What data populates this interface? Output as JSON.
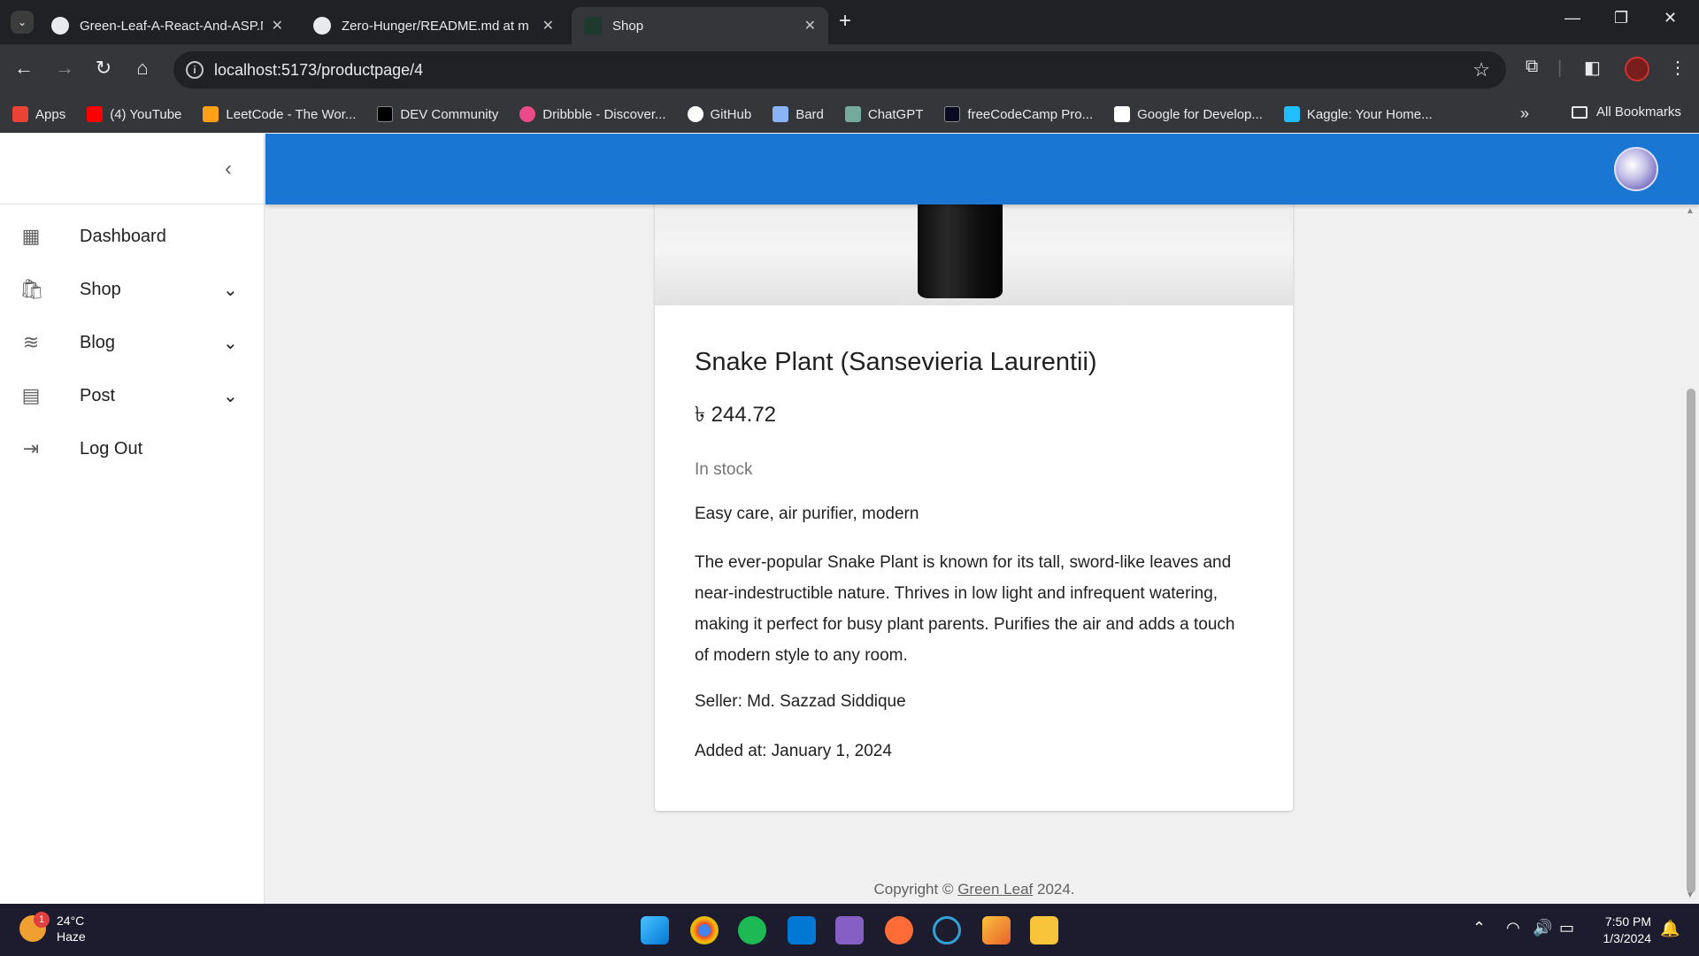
{
  "browser": {
    "tabs": [
      {
        "title": "Green-Leaf-A-React-And-ASP.N",
        "active": false
      },
      {
        "title": "Zero-Hunger/README.md at m",
        "active": false
      },
      {
        "title": "Shop",
        "active": true
      }
    ],
    "new_tab": "+",
    "url": "localhost:5173/productpage/4",
    "bookmarks": [
      {
        "label": "Apps",
        "icon": "apps-grid-icon",
        "color": "#ea4335"
      },
      {
        "label": "(4) YouTube",
        "icon": "youtube-icon",
        "color": "#ff0000"
      },
      {
        "label": "LeetCode - The Wor...",
        "icon": "leetcode-icon",
        "color": "#ffa116"
      },
      {
        "label": "DEV Community",
        "icon": "dev-icon",
        "color": "#000000"
      },
      {
        "label": "Dribbble - Discover...",
        "icon": "dribbble-icon",
        "color": "#ea4c89"
      },
      {
        "label": "GitHub",
        "icon": "github-icon",
        "color": "#ffffff"
      },
      {
        "label": "Bard",
        "icon": "bard-icon",
        "color": "#8ab4f8"
      },
      {
        "label": "ChatGPT",
        "icon": "chatgpt-icon",
        "color": "#74aa9c"
      },
      {
        "label": "freeCodeCamp Pro...",
        "icon": "freecodecamp-icon",
        "color": "#0a0a23"
      },
      {
        "label": "Google for Develop...",
        "icon": "google-icon",
        "color": "#4285f4"
      },
      {
        "label": "Kaggle: Your Home...",
        "icon": "kaggle-icon",
        "color": "#20beff"
      }
    ],
    "more_bookmarks": "»",
    "all_bookmarks": "All Bookmarks"
  },
  "sidebar": {
    "items": [
      {
        "label": "Dashboard",
        "icon": "dashboard-icon",
        "glyph": "▦",
        "chevron": false
      },
      {
        "label": "Shop",
        "icon": "shopping-bag-icon",
        "glyph": "🛍",
        "chevron": true
      },
      {
        "label": "Blog",
        "icon": "rss-feed-icon",
        "glyph": "≋",
        "chevron": true
      },
      {
        "label": "Post",
        "icon": "post-add-icon",
        "glyph": "▤",
        "chevron": true
      },
      {
        "label": "Log Out",
        "icon": "logout-icon",
        "glyph": "⇥",
        "chevron": false
      }
    ]
  },
  "product": {
    "title": "Snake Plant (Sansevieria Laurentii)",
    "price": "৳ 244.72",
    "stock": "In stock",
    "tags": "Easy care, air purifier, modern",
    "description": "The ever-popular Snake Plant is known for its tall, sword-like leaves and near-indestructible nature. Thrives in low light and infrequent watering, making it perfect for busy plant parents. Purifies the air and adds a touch of modern style to any room.",
    "seller": "Seller: Md. Sazzad Siddique",
    "added": "Added at: January 1, 2024"
  },
  "footer": {
    "prefix": "Copyright © ",
    "link": "Green Leaf",
    "suffix": " 2024."
  },
  "taskbar": {
    "weather_temp": "24°C",
    "weather_cond": "Haze",
    "weather_badge": "1",
    "time": "7:50 PM",
    "date": "1/3/2024"
  },
  "colors": {
    "appbar": "#1976d2",
    "chrome_dark": "#202124",
    "chrome_toolbar": "#35363a"
  }
}
